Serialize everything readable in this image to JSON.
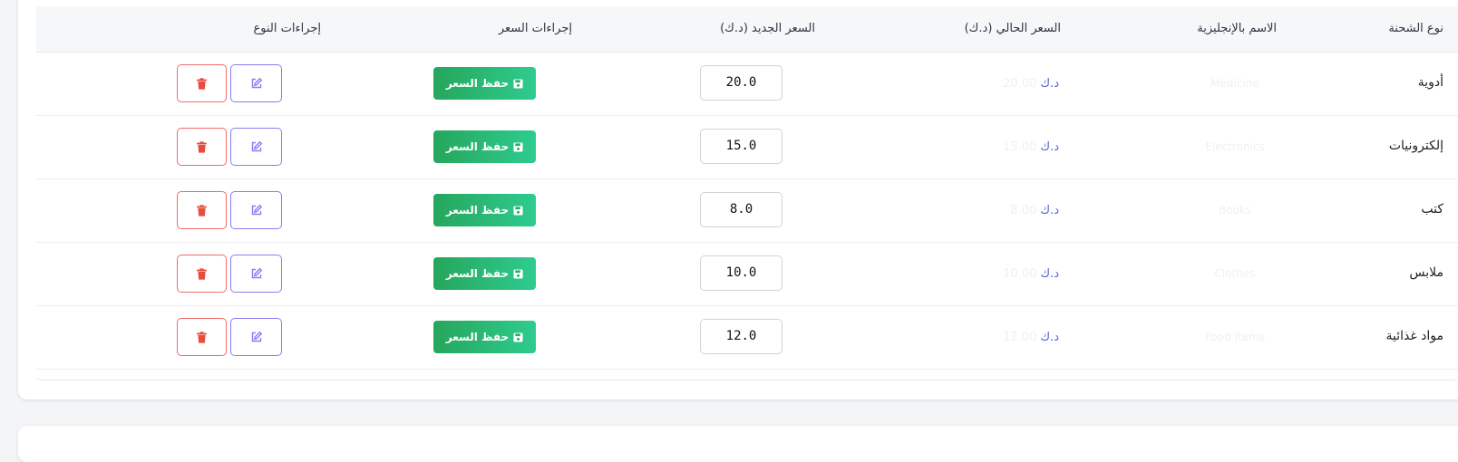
{
  "table": {
    "headers": {
      "type": "نوع الشحنة",
      "english_name": "الاسم بالإنجليزية",
      "current_price": "السعر الحالي (د.ك)",
      "new_price": "السعر الجديد (د.ك)",
      "price_actions": "إجراءات السعر",
      "type_actions": "إجراءات النوع"
    },
    "currency": "د.ك",
    "save_label": "حفظ السعر",
    "rows": [
      {
        "type": "أدوية",
        "english_name": "Medicine",
        "current_price": "20.00",
        "new_price": "20.0"
      },
      {
        "type": "إلكترونيات",
        "english_name": "Electronics",
        "current_price": "15.00",
        "new_price": "15.0"
      },
      {
        "type": "كتب",
        "english_name": "Books",
        "current_price": "8.00",
        "new_price": "8.0"
      },
      {
        "type": "ملابس",
        "english_name": "Clothes",
        "current_price": "10.00",
        "new_price": "10.0"
      },
      {
        "type": "مواد غذائية",
        "english_name": "Food Items",
        "current_price": "12.00",
        "new_price": "12.0"
      }
    ]
  },
  "colors": {
    "save_button": "#27ae60",
    "edit_border": "#8e7cf0",
    "delete_border": "#f06a6a",
    "currency_text": "#4f63d2"
  },
  "icons": {
    "save": "floppy-disk-icon",
    "edit": "pencil-square-icon",
    "delete": "trash-icon"
  }
}
